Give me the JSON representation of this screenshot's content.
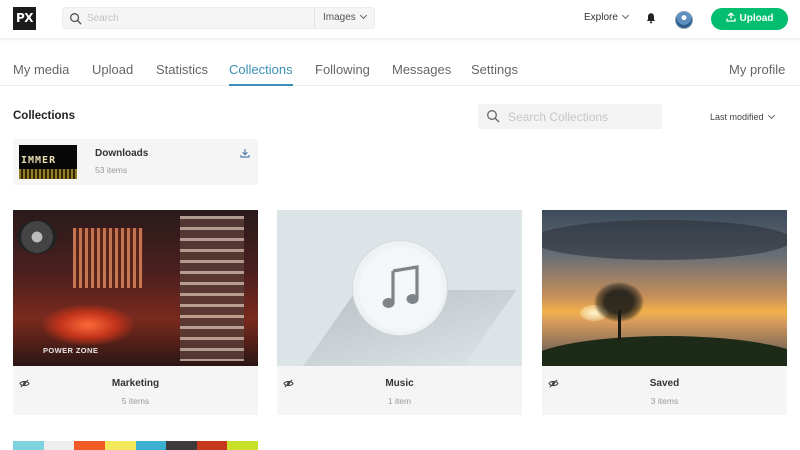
{
  "header": {
    "logo_text": "PX",
    "search_placeholder": "Search",
    "search_type": "Images",
    "explore_label": "Explore",
    "upload_label": "Upload"
  },
  "tabs": [
    {
      "label": "My media"
    },
    {
      "label": "Upload"
    },
    {
      "label": "Statistics"
    },
    {
      "label": "Collections",
      "active": true
    },
    {
      "label": "Following"
    },
    {
      "label": "Messages"
    },
    {
      "label": "Settings"
    }
  ],
  "my_profile_label": "My profile",
  "collections": {
    "title": "Collections",
    "search_placeholder": "Search Collections",
    "sort_label": "Last modified",
    "downloads": {
      "name": "Downloads",
      "count": "53 items",
      "thumb_text": "IMMER"
    },
    "cards": [
      {
        "name": "Marketing",
        "count": "5 items",
        "thumb_text": "POWER ZONE"
      },
      {
        "name": "Music",
        "count": "1 item"
      },
      {
        "name": "Saved",
        "count": "3 items"
      }
    ],
    "palette": [
      "#7fd3df",
      "#eeeeee",
      "#f05a24",
      "#f3e75a",
      "#3db0d2",
      "#3f3a3a",
      "#c6381a",
      "#c9e02a"
    ]
  },
  "colors": {
    "accent": "#3a8fb7",
    "upload_green": "#02be6e"
  }
}
